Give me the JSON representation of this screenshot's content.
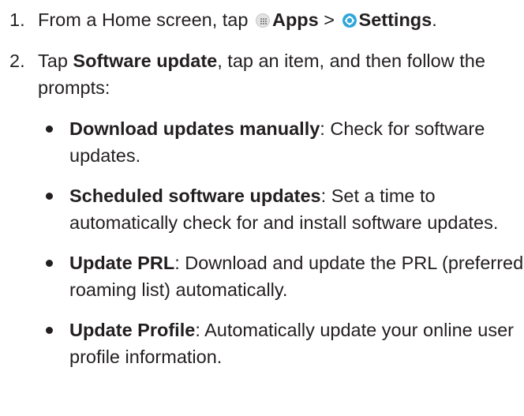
{
  "steps": [
    {
      "num": "1.",
      "parts": {
        "t1": "From a Home screen, tap ",
        "apps": "Apps",
        "t2": " > ",
        "settings": "Settings",
        "t3": "."
      }
    },
    {
      "num": "2.",
      "parts": {
        "t1": "Tap ",
        "b1": "Software update",
        "t2": ", tap an item, and then follow the prompts:"
      },
      "bullets": [
        {
          "term": "Download updates manually",
          "desc": ": Check for software updates."
        },
        {
          "term": "Scheduled software updates",
          "desc": ": Set a time to automatically check for and install software updates."
        },
        {
          "term": "Update PRL",
          "desc": ": Download and update the PRL (preferred roaming list) automatically."
        },
        {
          "term": "Update Profile",
          "desc": ": Automatically update your online user profile information."
        }
      ]
    }
  ],
  "icons": {
    "apps": "apps-icon",
    "settings": "settings-gear-icon"
  }
}
